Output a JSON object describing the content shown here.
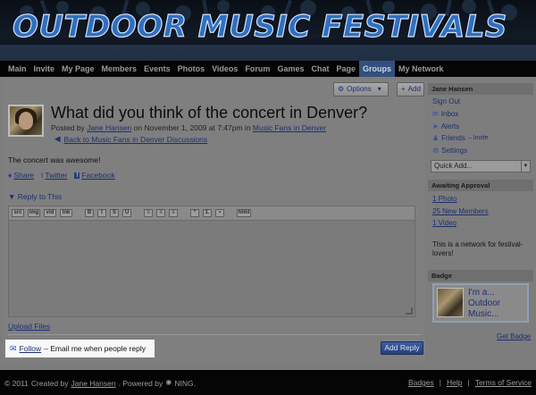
{
  "site": {
    "title": "OUTDOOR MUSIC FESTIVALS"
  },
  "nav": {
    "items": [
      "Main",
      "Invite",
      "My Page",
      "Members",
      "Events",
      "Photos",
      "Videos",
      "Forum",
      "Games",
      "Chat",
      "Page",
      "Groups",
      "My Network"
    ],
    "active": "Groups"
  },
  "toolbar": {
    "options_label": "Options",
    "add_label": "Add"
  },
  "post": {
    "title": "What did you think of the concert in Denver?",
    "posted_by_prefix": "Posted by",
    "author": "Jane Hansen",
    "date_text": "on November 1, 2009 at 7:47pm in",
    "group_link": "Music Fans in Denver",
    "back_link": "Back to Music Fans in Denver Discussions",
    "body": "The concert was awesome!"
  },
  "share": {
    "share": "Share",
    "twitter": "Twitter",
    "facebook": "Facebook"
  },
  "reply": {
    "toggle_label": "Reply to This",
    "upload_files": "Upload Files",
    "follow_link": "Follow",
    "follow_suffix": "– Email me when people reply",
    "add_reply": "Add Reply"
  },
  "editor": {
    "tools": [
      "src",
      "img",
      "vid",
      "lnk",
      "B",
      "I",
      "S",
      "U",
      "≡",
      "≡",
      "≡",
      "“",
      "1.",
      "•",
      "html"
    ]
  },
  "sidebar": {
    "user_name": "Jane Hansen",
    "sign_out": "Sign Out",
    "inbox": "Inbox",
    "alerts": "Alerts",
    "friends": "Friends",
    "invite": "– Invite",
    "settings": "Settings",
    "quick_add": "Quick Add...",
    "awaiting_header": "Awaiting Approval",
    "photo": "1 Photo",
    "new_members": "25 New Members",
    "video": "1 Video",
    "network_note": "This is a network for festival-lovers!",
    "badge_header": "Badge",
    "badge_text": "I'm a... Outdoor Music...",
    "get_badge": "Get Badge"
  },
  "footer": {
    "copyright": "© 2011",
    "created_by": "Created by",
    "creator": "Jane Hansen",
    "powered_by": ".   Powered by",
    "ning": "NING.",
    "badges": "Badges",
    "help": "Help",
    "terms": "Terms of Service"
  },
  "colors": {
    "accent": "#33507e",
    "link": "#1b2f72",
    "overlay": "#7d7d7d"
  }
}
